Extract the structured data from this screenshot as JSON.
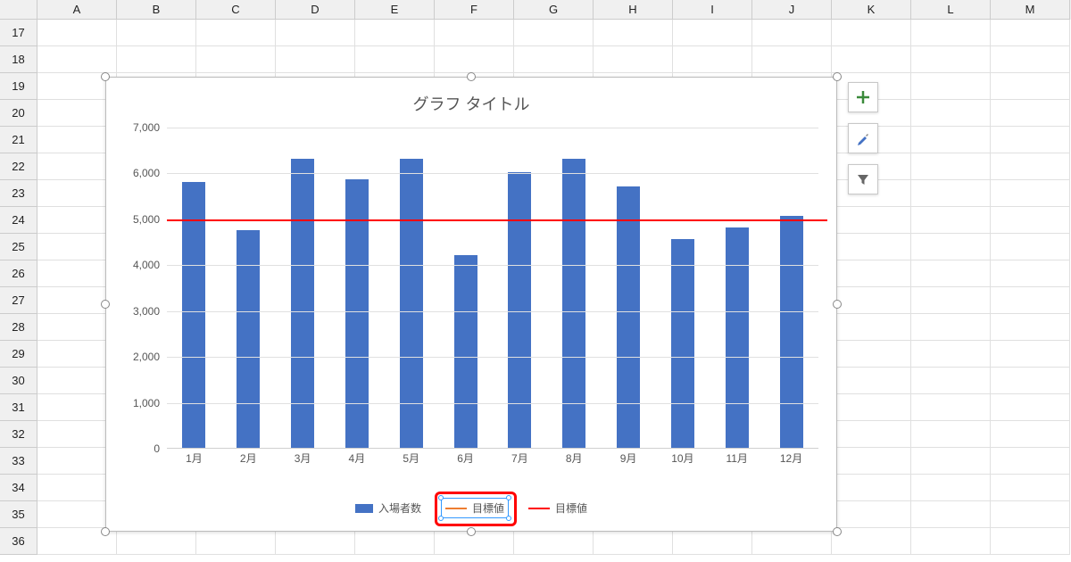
{
  "columns": [
    "A",
    "B",
    "C",
    "D",
    "E",
    "F",
    "G",
    "H",
    "I",
    "J",
    "K",
    "L",
    "M"
  ],
  "rows": [
    17,
    18,
    19,
    20,
    21,
    22,
    23,
    24,
    25,
    26,
    27,
    28,
    29,
    30,
    31,
    32,
    33,
    34,
    35,
    36
  ],
  "chart_title": "グラフ タイトル",
  "y_ticks": [
    "7,000",
    "6,000",
    "5,000",
    "4,000",
    "3,000",
    "2,000",
    "1,000",
    "0"
  ],
  "legend": {
    "bar": "入場者数",
    "target_orange": "目標値",
    "target_red": "目標値"
  },
  "chart_data": {
    "type": "bar",
    "title": "グラフ タイトル",
    "xlabel": "",
    "ylabel": "",
    "ylim": [
      0,
      7000
    ],
    "categories": [
      "1月",
      "2月",
      "3月",
      "4月",
      "5月",
      "6月",
      "7月",
      "8月",
      "9月",
      "10月",
      "11月",
      "12月"
    ],
    "series": [
      {
        "name": "入場者数",
        "type": "bar",
        "color": "#4472c4",
        "values": [
          5800,
          4750,
          6300,
          5850,
          6300,
          4200,
          6000,
          6300,
          5700,
          4550,
          4800,
          5050
        ]
      },
      {
        "name": "目標値",
        "type": "line",
        "color": "#ed7d31",
        "values": [
          5000,
          5000,
          5000,
          5000,
          5000,
          5000,
          5000,
          5000,
          5000,
          5000,
          5000,
          5000
        ]
      },
      {
        "name": "目標値",
        "type": "line",
        "color": "#ff0000",
        "values": [
          5000,
          5000,
          5000,
          5000,
          5000,
          5000,
          5000,
          5000,
          5000,
          5000,
          5000,
          5000
        ]
      }
    ]
  }
}
